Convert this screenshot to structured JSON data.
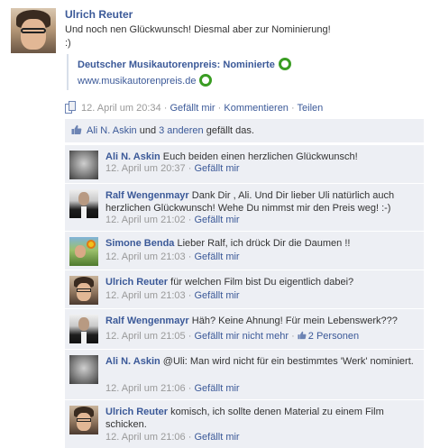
{
  "post": {
    "author": "Ulrich Reuter",
    "text_line1": "Und noch nen Glückwunsch! Diesmal aber zur Nominierung!",
    "text_line2": ":)",
    "share_title": "Deutscher Musikautorenpreis: Nominierte",
    "share_url": "www.musikautorenpreis.de",
    "timestamp": "12. April um 20:34",
    "like_label": "Gefällt mir",
    "comment_label": "Kommentieren",
    "share_label": "Teilen",
    "separator": "·"
  },
  "likes": {
    "first_liker": "Ali N. Askin",
    "conjunction": "und",
    "others_link": "3 anderen",
    "suffix": "gefällt das."
  },
  "comments": [
    {
      "author": "Ali N. Askin",
      "text": "Euch beiden einen herzlichen Glückwunsch!",
      "timestamp": "12. April um 20:37",
      "like_label": "Gefällt mir",
      "avatar": "ali"
    },
    {
      "author": "Ralf Wengenmayr",
      "text": "Dank Dir , Ali. Und Dir lieber Uli natürlich auch herzlichen Glückwunsch! Wehe Du nimmst mir den Preis weg! :-)",
      "timestamp": "12. April um 21:02",
      "like_label": "Gefällt mir",
      "avatar": "ralf"
    },
    {
      "author": "Simone Benda",
      "text": "Lieber Ralf, ich drück Dir die Daumen !!",
      "timestamp": "12. April um 21:03",
      "like_label": "Gefällt mir",
      "avatar": "simone"
    },
    {
      "author": "Ulrich Reuter",
      "text": "für welchen Film bist Du eigentlich dabei?",
      "timestamp": "12. April um 21:03",
      "like_label": "Gefällt mir",
      "avatar": "uli"
    },
    {
      "author": "Ralf Wengenmayr",
      "text": "Häh? Keine Ahnung! Für mein Lebenswerk???",
      "timestamp": "12. April um 21:05",
      "like_label": "Gefällt mir nicht mehr",
      "likes_count": "2 Personen",
      "avatar": "ralf"
    },
    {
      "author": "Ali N. Askin",
      "text": "@Uli: Man wird nicht für ein bestimmtes 'Werk' nominiert.",
      "timestamp": "12. April um 21:06",
      "like_label": "Gefällt mir",
      "avatar": "ali"
    },
    {
      "author": "Ulrich Reuter",
      "text": "komisch, ich sollte denen Material zu einem Film schicken.",
      "timestamp": "12. April um 21:06",
      "like_label": "Gefällt mir",
      "avatar": "uli"
    }
  ],
  "colors": {
    "link": "#3b5998",
    "meta": "#999999",
    "comment_bg": "#edeff4",
    "ring_icon": "#3a9d23"
  },
  "icons": {
    "share_ring": "green-ring-icon",
    "post_type": "document-icon",
    "like": "thumbs-up-icon"
  }
}
